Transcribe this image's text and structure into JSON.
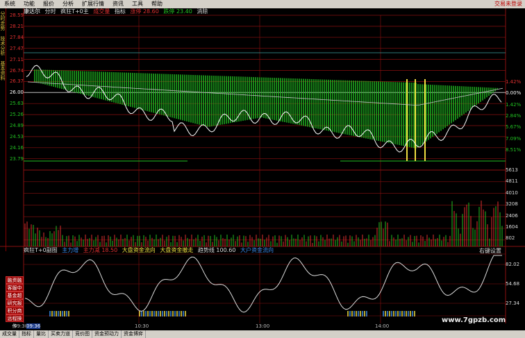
{
  "menu": {
    "items": [
      "系统",
      "功能",
      "报价",
      "分析",
      "扩展行情",
      "资讯",
      "工具",
      "帮助"
    ],
    "right_text": "交易未登录"
  },
  "left_tabs": [
    "分时走势",
    "技术分析",
    "基本资料"
  ],
  "info": {
    "name": "康达尔",
    "mode": "分时",
    "indicator": "疯狂T+0主",
    "vol_label": "成交量",
    "zhibiao": "指标",
    "up": "涨停 28.60",
    "down": "跌停 23.40",
    "restore": "消除"
  },
  "price_axis": [
    "28.59",
    "28.21",
    "27.84",
    "27.47",
    "27.11",
    "26.74",
    "26.37",
    "26.00",
    "25.63",
    "25.26",
    "24.89",
    "24.53",
    "24.16",
    "23.79"
  ],
  "pct_axis": [
    "1.42%",
    "0.00%",
    "1.42%",
    "2.84%",
    "5.67%",
    "7.09%",
    "8.51%"
  ],
  "vol_axis": [
    "5613",
    "4811",
    "4010",
    "3208",
    "2406",
    "1604",
    "802"
  ],
  "sub_info": {
    "title": "疯狂T+0副图",
    "a": "主力增",
    "b": "主力减 18.50",
    "c": "大盘资金流向",
    "d": "大盘资金撤走",
    "e": "趋势线 100.60",
    "f": "大户资金流向"
  },
  "sub_axis": [
    "82.02",
    "54.68",
    "27.34"
  ],
  "side_buttons": [
    "融资融券",
    "客服中心",
    "基金超市",
    "研究报告",
    "积分商城",
    "远程操作"
  ],
  "settings": "右键设置",
  "time_labels": [
    "09:30",
    "09:36",
    "10:30",
    "13:00",
    "14:00"
  ],
  "bottom_tabs": [
    "成交量",
    "指标",
    "量比",
    "买卖力道",
    "竞价图",
    "资金预动力",
    "资金博弈"
  ],
  "watermark": "www.7gpzb.com",
  "colors": {
    "green": "#22c022",
    "red": "#e03030",
    "yellow": "#f0e040",
    "white": "#ffffff"
  }
}
